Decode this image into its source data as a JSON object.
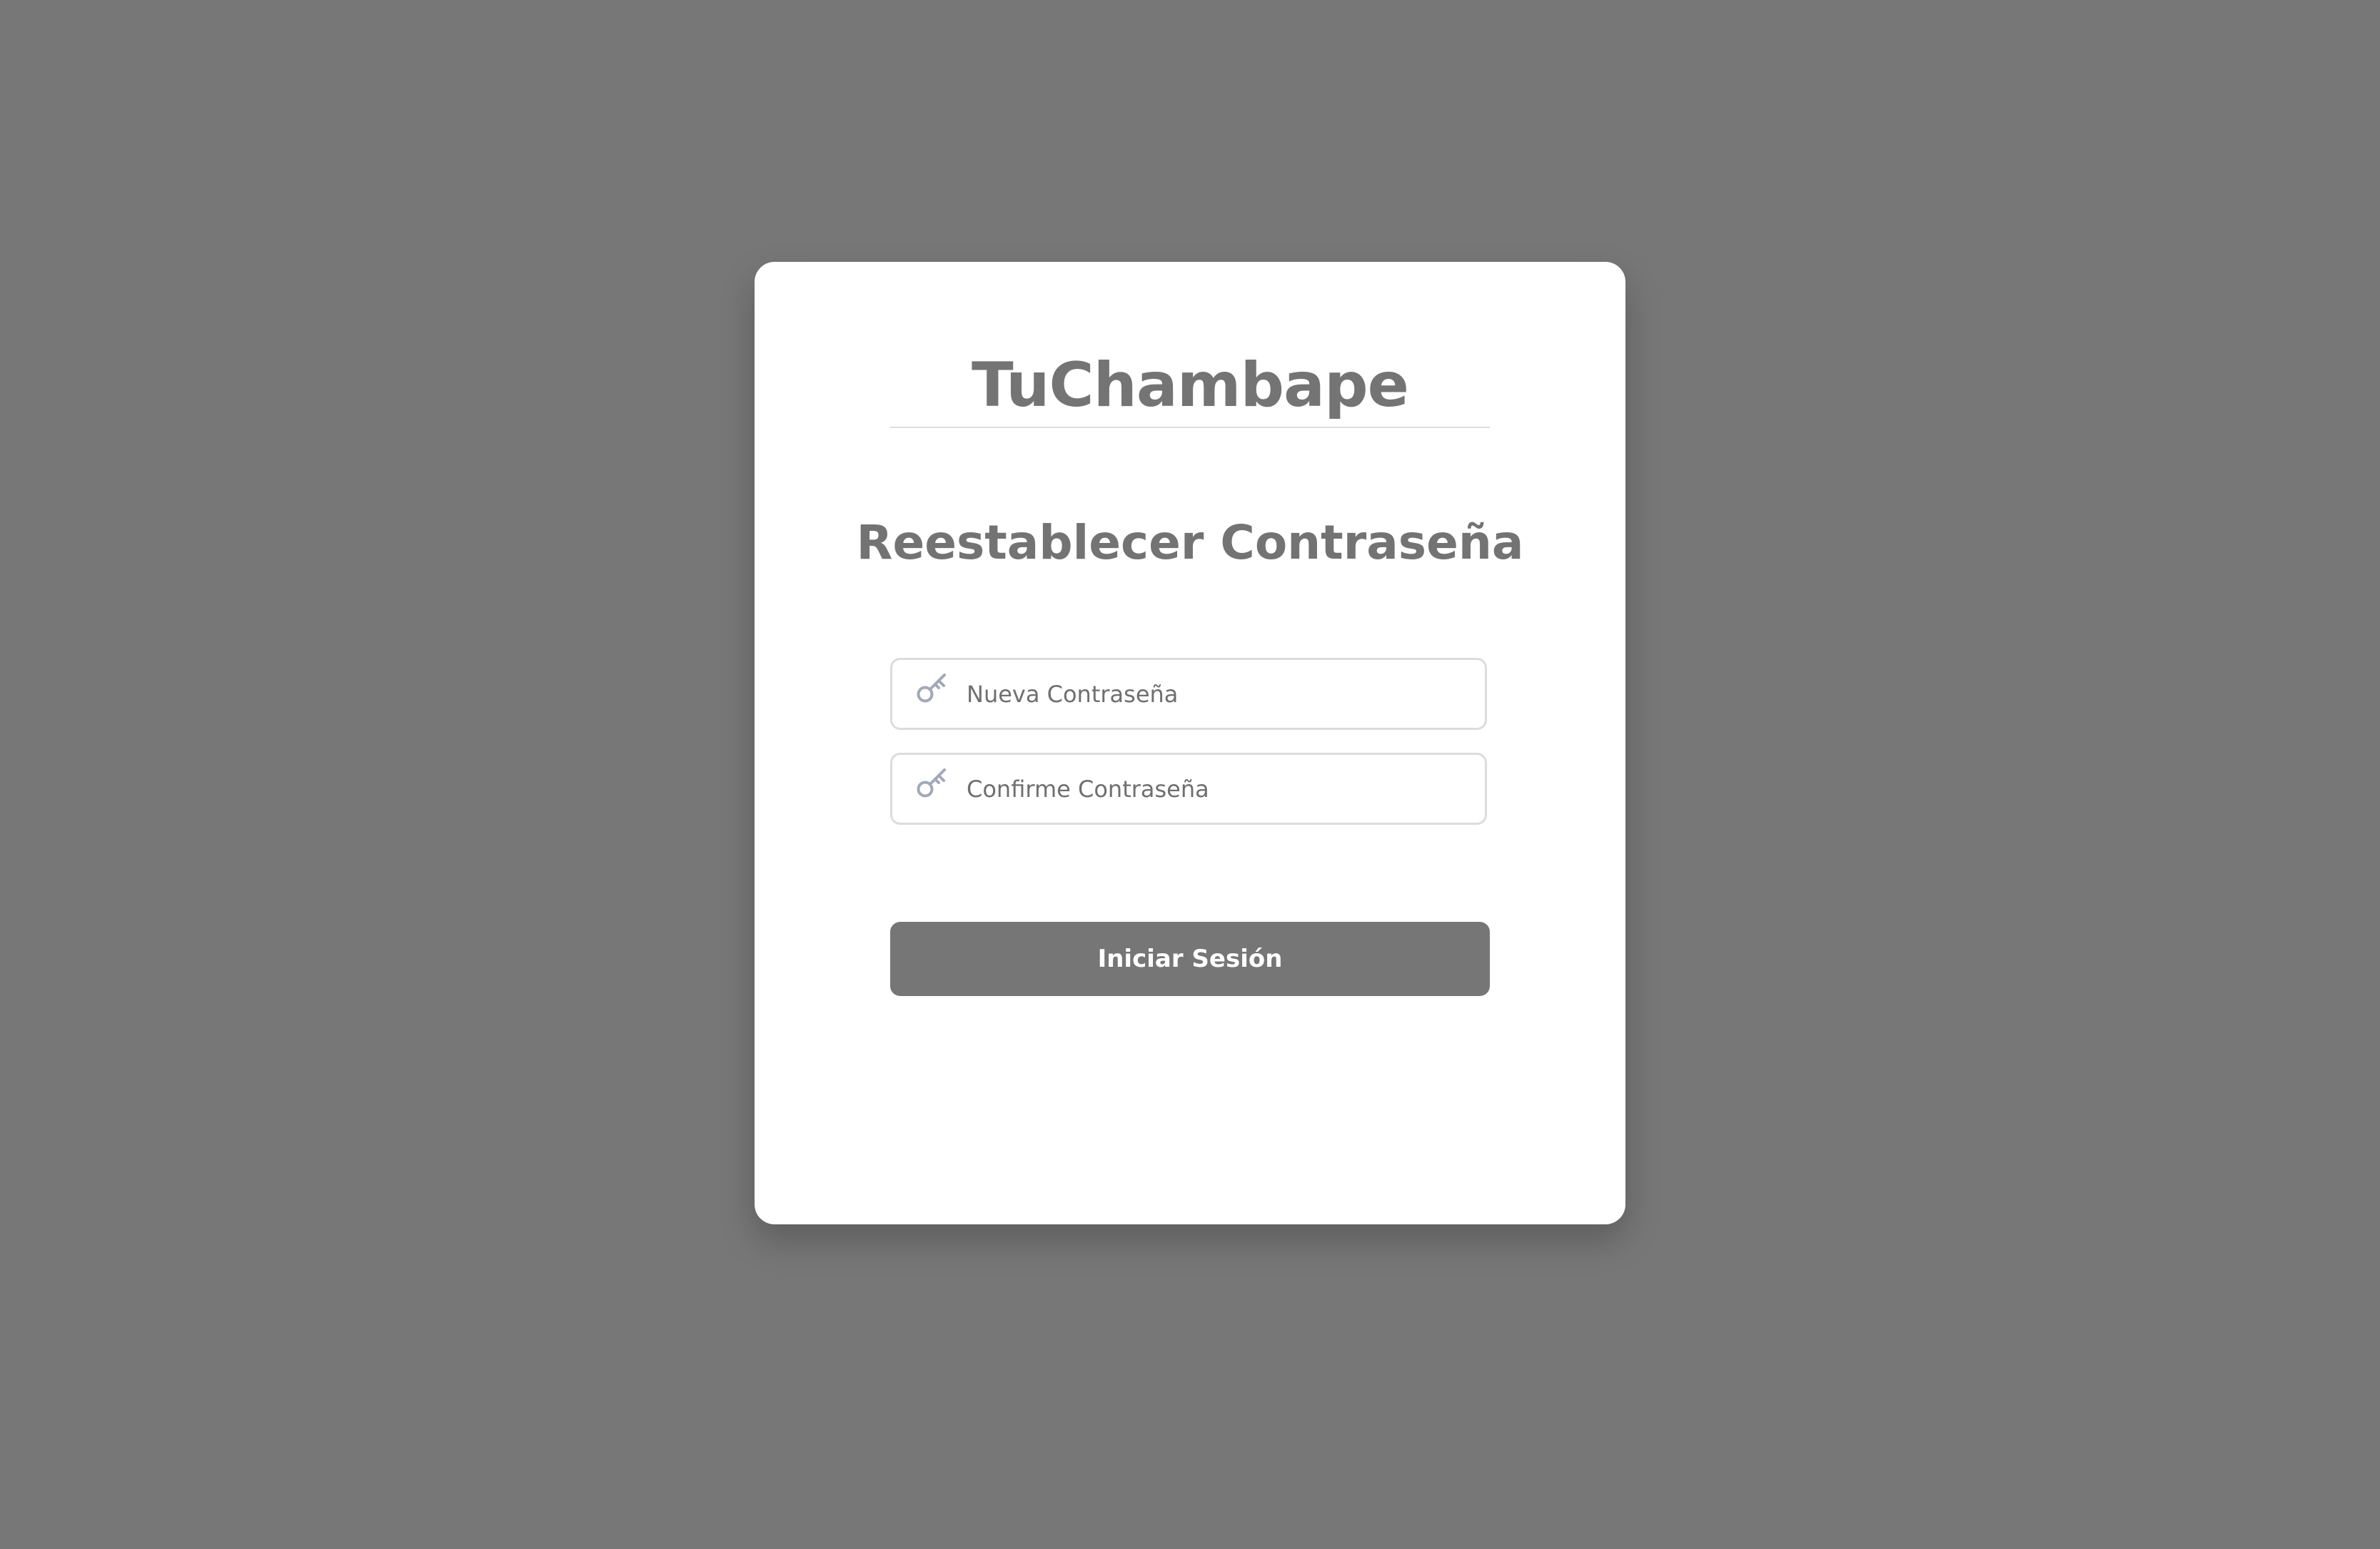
{
  "brand": {
    "name": "TuChambape"
  },
  "form": {
    "title": "Reestablecer Contraseña",
    "new_password": {
      "placeholder": "Nueva Contraseña",
      "value": "",
      "icon": "key-icon"
    },
    "confirm_password": {
      "placeholder": "Confirme Contraseña",
      "value": "",
      "icon": "key-icon"
    },
    "submit_label": "Iniciar Sesión"
  },
  "colors": {
    "background": "#767776",
    "card": "#ffffff",
    "text": "#747474",
    "button": "#767676",
    "icon": "#a3a8b8",
    "field_border": "#dcdcdf"
  }
}
